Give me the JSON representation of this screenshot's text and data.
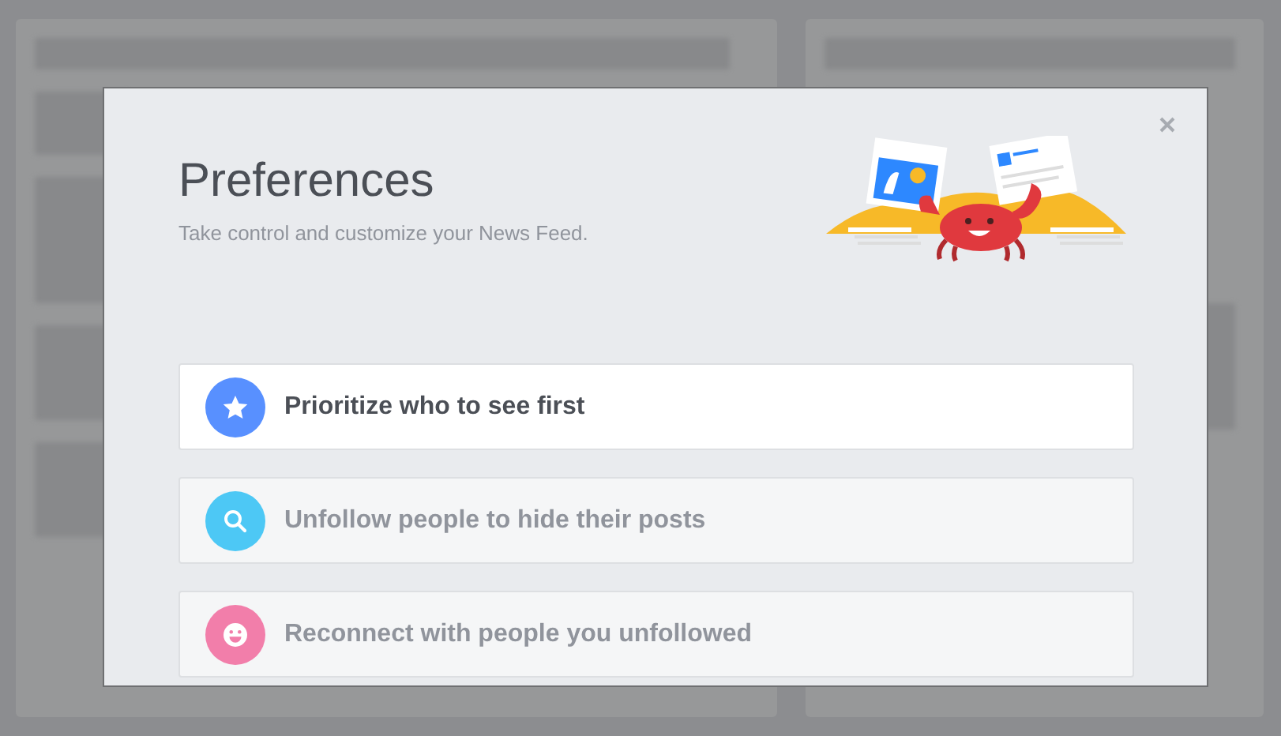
{
  "dialog": {
    "title": "Preferences",
    "subtitle": "Take control and customize your News Feed.",
    "options": [
      {
        "kind": "star",
        "label": "Prioritize who to see first",
        "color": "#5890ff",
        "selected": true
      },
      {
        "kind": "search",
        "label": "Unfollow people to hide their posts",
        "color": "#4dc8f5",
        "selected": false
      },
      {
        "kind": "smile",
        "label": "Reconnect with people you unfollowed",
        "color": "#f27eaa",
        "selected": false
      }
    ]
  }
}
